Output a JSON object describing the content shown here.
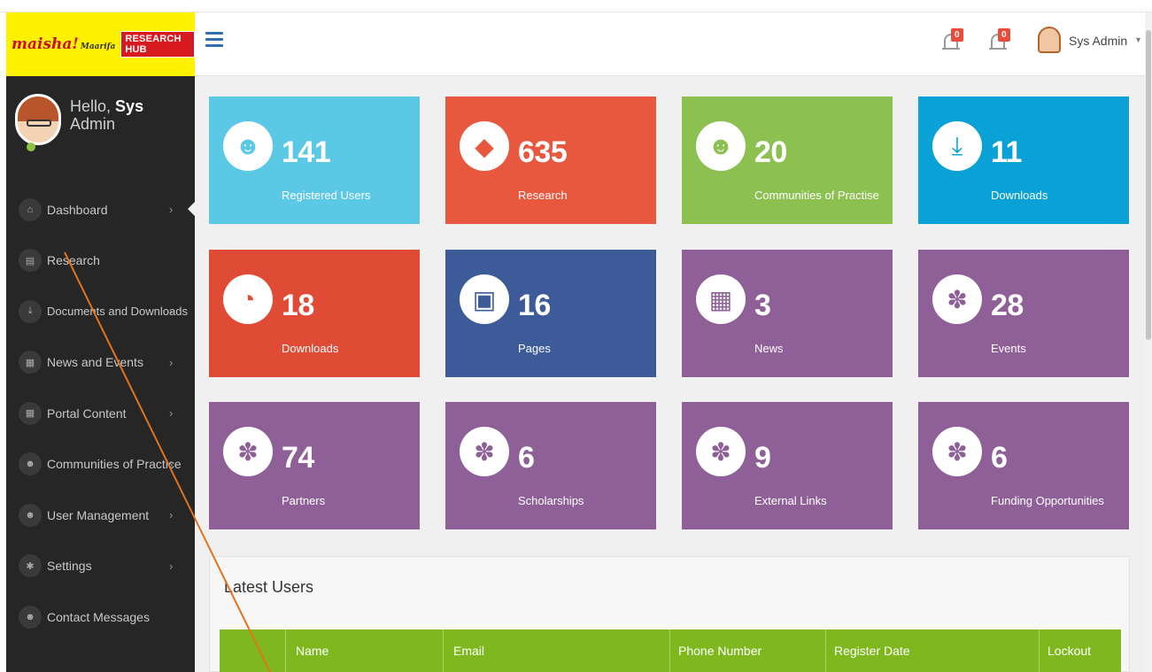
{
  "logo": {
    "brand": "maisha!",
    "brand_sub": "Maarifa",
    "tag": "RESEARCH HUB"
  },
  "topbar": {
    "notifications": [
      {
        "count": "0"
      },
      {
        "count": "0"
      }
    ],
    "user_name": "Sys Admin",
    "caret": "▾"
  },
  "sidebar": {
    "greeting": "Hello,",
    "first_name": "Sys",
    "last_name": "Admin",
    "items": [
      {
        "label": "Dashboard",
        "icon": "home-icon",
        "glyph": "⌂",
        "chevron": "›"
      },
      {
        "label": "Research",
        "icon": "file-icon",
        "glyph": "▤",
        "chevron": ""
      },
      {
        "label": "Documents and Downloads",
        "icon": "download-icon",
        "glyph": "⤓",
        "chevron": "›"
      },
      {
        "label": "News and Events",
        "icon": "newspaper-icon",
        "glyph": "▦",
        "chevron": "›"
      },
      {
        "label": "Portal Content",
        "icon": "newspaper-icon",
        "glyph": "▦",
        "chevron": "›"
      },
      {
        "label": "Communities of Practice",
        "icon": "users-icon",
        "glyph": "☻",
        "chevron": "›"
      },
      {
        "label": "User Management",
        "icon": "users-icon",
        "glyph": "☻",
        "chevron": "›"
      },
      {
        "label": "Settings",
        "icon": "cogs-icon",
        "glyph": "✱",
        "chevron": "›"
      },
      {
        "label": "Contact Messages",
        "icon": "users-icon",
        "glyph": "☻",
        "chevron": ""
      }
    ]
  },
  "tiles": [
    {
      "value": "141",
      "label": "Registered Users",
      "color": "#5bc8e6",
      "icon": "users-icon",
      "glyph": "☻"
    },
    {
      "value": "635",
      "label": "Research",
      "color": "#e8583e",
      "icon": "tag-icon",
      "glyph": "◆"
    },
    {
      "value": "20",
      "label": "Communities of Practise",
      "color": "#8cc152",
      "icon": "users-icon",
      "glyph": "☻"
    },
    {
      "value": "11",
      "label": "Downloads",
      "color": "#0aa1d6",
      "icon": "download-icon",
      "glyph": "⤓"
    },
    {
      "value": "18",
      "label": "Downloads",
      "color": "#e04b36",
      "icon": "pie-chart-icon",
      "glyph": "◔"
    },
    {
      "value": "16",
      "label": "Pages",
      "color": "#3d5b99",
      "icon": "archive-icon",
      "glyph": "▣"
    },
    {
      "value": "3",
      "label": "News",
      "color": "#8e6097",
      "icon": "newspaper-icon",
      "glyph": "▦"
    },
    {
      "value": "28",
      "label": "Events",
      "color": "#8e6097",
      "icon": "paw-icon",
      "glyph": "✽"
    },
    {
      "value": "74",
      "label": "Partners",
      "color": "#8e6097",
      "icon": "paw-icon",
      "glyph": "✽"
    },
    {
      "value": "6",
      "label": "Scholarships",
      "color": "#8e6097",
      "icon": "paw-icon",
      "glyph": "✽"
    },
    {
      "value": "9",
      "label": "External Links",
      "color": "#8e6097",
      "icon": "paw-icon",
      "glyph": "✽"
    },
    {
      "value": "6",
      "label": "Funding Opportunities",
      "color": "#8e6097",
      "icon": "paw-icon",
      "glyph": "✽"
    }
  ],
  "latest_users": {
    "title": "Latest Users",
    "columns": [
      "Name",
      "Email",
      "Phone Number",
      "Register Date",
      "Lockout"
    ],
    "header_color": "#7fb81e"
  }
}
